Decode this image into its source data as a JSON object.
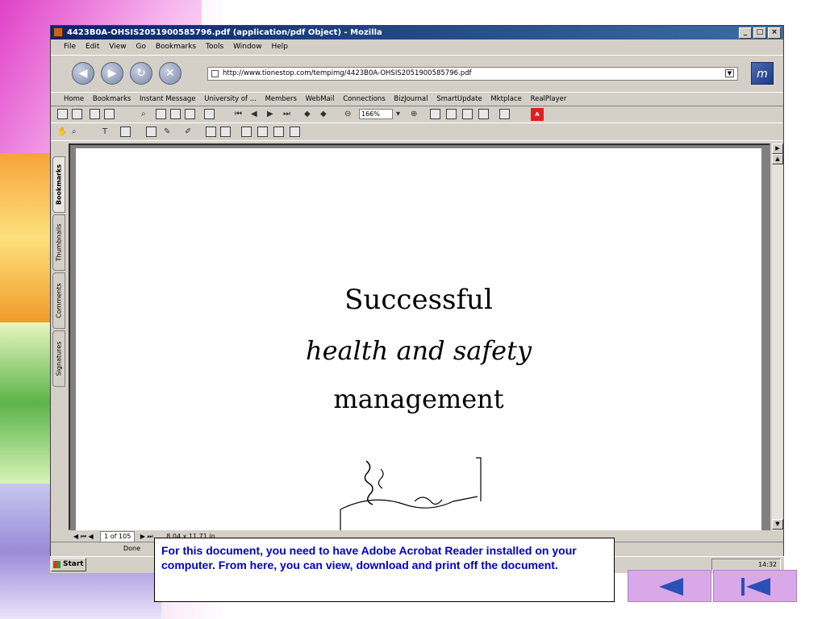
{
  "window": {
    "title": "4423B0A-OHSIS2051900585796.pdf (application/pdf Object) - Mozilla",
    "controls": [
      "_",
      "□",
      "×"
    ]
  },
  "menu": [
    "File",
    "Edit",
    "View",
    "Go",
    "Bookmarks",
    "Tools",
    "Window",
    "Help"
  ],
  "address": {
    "url": "http://www.tionestop.com/tempimg/4423B0A-OHSIS2051900585796.pdf"
  },
  "bookmarks": [
    "Home",
    "Bookmarks",
    "Instant Message",
    "University of ...",
    "Members",
    "WebMail",
    "Connections",
    "BizJournal",
    "SmartUpdate",
    "Mktplace",
    "RealPlayer"
  ],
  "pdf_toolbar": {
    "zoom": "166%"
  },
  "side_tabs": [
    "Bookmarks",
    "Thumbnails",
    "Comments",
    "Signatures"
  ],
  "document": {
    "line1": "Successful",
    "line2": "health  and  safety",
    "line3": "management"
  },
  "pdf_status": {
    "page": "1 of 105",
    "size": "8.04 x 11.71 in"
  },
  "status": {
    "text": "Done"
  },
  "taskbar": {
    "start": "Start",
    "clock": "14:32"
  },
  "callout": {
    "text": "For this document, you need to have Adobe Acrobat Reader installed on your computer.  From here, you can view, download and print off the document."
  },
  "colors": {
    "callout_text": "#0000cc",
    "nav_button": "#d8a8e8",
    "nav_arrow": "#2a50b8",
    "titlebar": "#0a246a"
  }
}
